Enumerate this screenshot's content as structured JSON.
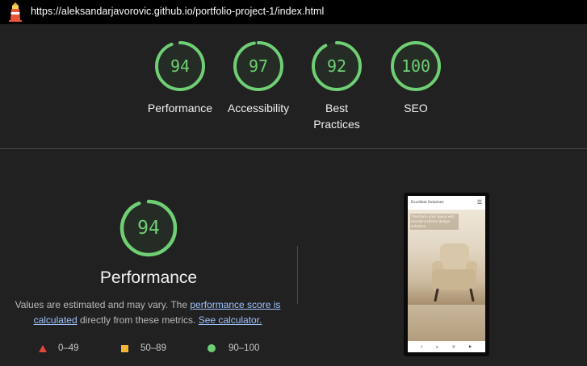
{
  "url": "https://aleksandarjavorovic.github.io/portfolio-project-1/index.html",
  "colors": {
    "pass": "#6fcf74",
    "average": "#f2b636",
    "fail": "#e0473a",
    "background": "#212121",
    "topbar": "#000000"
  },
  "scores": [
    {
      "label": "Performance",
      "value": "94",
      "fraction": 0.94
    },
    {
      "label": "Accessibility",
      "value": "97",
      "fraction": 0.97
    },
    {
      "label_lines": [
        "Best",
        "Practices"
      ],
      "value": "92",
      "fraction": 0.92
    },
    {
      "label": "SEO",
      "value": "100",
      "fraction": 1.0
    }
  ],
  "detail": {
    "value": "94",
    "fraction": 0.94,
    "title": "Performance",
    "desc_pre": "Values are estimated and may vary. The ",
    "desc_link1": "performance score is calculated",
    "desc_mid": " directly from these metrics. ",
    "desc_link2": "See calculator."
  },
  "legend": [
    {
      "shape": "triangle",
      "range": "0–49"
    },
    {
      "shape": "square",
      "range": "50–89"
    },
    {
      "shape": "circle",
      "range": "90–100"
    }
  ],
  "preview": {
    "brand": "Excellent Solutions",
    "menu_icon": "hamburger-icon",
    "hero_text": "Transform your space with excellent interior design solutions",
    "footer_icons": [
      "facebook-icon",
      "x-icon",
      "instagram-icon",
      "youtube-icon"
    ],
    "footer_glyphs": [
      "f",
      "X",
      "◎",
      "▶"
    ]
  }
}
